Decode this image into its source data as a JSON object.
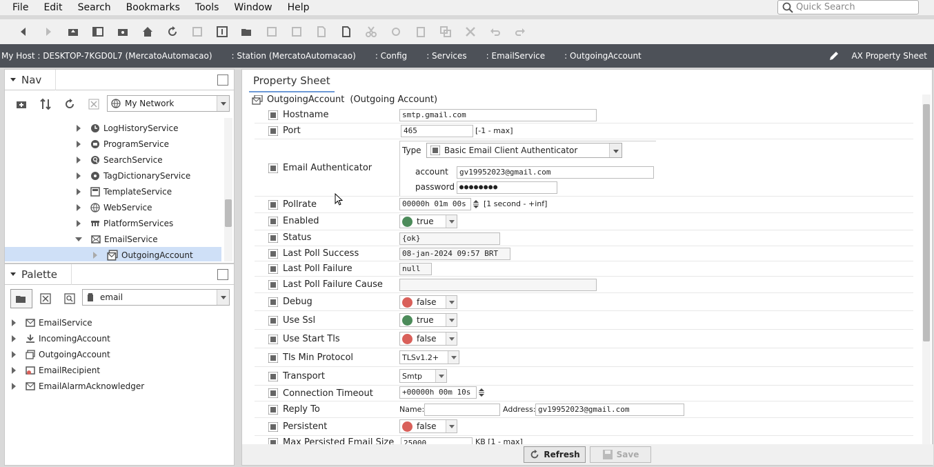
{
  "menu": [
    "File",
    "Edit",
    "Search",
    "Bookmarks",
    "Tools",
    "Window",
    "Help"
  ],
  "quick_search": {
    "placeholder": "Quick Search"
  },
  "breadcrumbs": [
    "My Host : DESKTOP-7KGD0L7 (MercatoAutomacao)",
    "Station (MercatoAutomacao)",
    "Config",
    "Services",
    "EmailService",
    "OutgoingAccount"
  ],
  "view_selector": "AX Property Sheet",
  "nav": {
    "title": "Nav",
    "network": "My Network",
    "items": [
      {
        "label": "LogHistoryService",
        "icon": "history-icon"
      },
      {
        "label": "ProgramService",
        "icon": "program-icon"
      },
      {
        "label": "SearchService",
        "icon": "search-icon"
      },
      {
        "label": "TagDictionaryService",
        "icon": "tag-icon"
      },
      {
        "label": "TemplateService",
        "icon": "template-icon"
      },
      {
        "label": "WebService",
        "icon": "globe-icon"
      },
      {
        "label": "PlatformServices",
        "icon": "platform-icon"
      },
      {
        "label": "EmailService",
        "icon": "email-icon"
      },
      {
        "label": "OutgoingAccount",
        "icon": "outgoing-mail-icon"
      }
    ]
  },
  "palette": {
    "title": "Palette",
    "module": "email",
    "items": [
      "EmailService",
      "IncomingAccount",
      "OutgoingAccount",
      "EmailRecipient",
      "EmailAlarmAcknowledger"
    ]
  },
  "property_sheet": {
    "tab": "Property Sheet",
    "root_name": "OutgoingAccount",
    "root_type": "(Outgoing Account)",
    "hostname": {
      "label": "Hostname",
      "value": "smtp.gmail.com"
    },
    "port": {
      "label": "Port",
      "value": "465",
      "hint": "[-1 - max]"
    },
    "authenticator": {
      "label": "Email Authenticator",
      "type_label": "Type",
      "type_value": "Basic Email Client Authenticator",
      "account_label": "account",
      "account_value": "gv19952023@gmail.com",
      "password_label": "password",
      "password_value": "●●●●●●●●"
    },
    "pollrate": {
      "label": "Pollrate",
      "value": "00000h 01m 00s",
      "hint": "[1 second - +inf]"
    },
    "enabled": {
      "label": "Enabled",
      "value": "true"
    },
    "status": {
      "label": "Status",
      "value": "{ok}"
    },
    "last_poll_success": {
      "label": "Last Poll Success",
      "value": "08-jan-2024 09:57 BRT"
    },
    "last_poll_failure": {
      "label": "Last Poll Failure",
      "value": "null"
    },
    "last_poll_failure_cause": {
      "label": "Last Poll Failure Cause",
      "value": ""
    },
    "debug": {
      "label": "Debug",
      "value": "false"
    },
    "use_ssl": {
      "label": "Use Ssl",
      "value": "true"
    },
    "use_start_tls": {
      "label": "Use Start Tls",
      "value": "false"
    },
    "tls_min_protocol": {
      "label": "Tls Min Protocol",
      "value": "TLSv1.2+"
    },
    "transport": {
      "label": "Transport",
      "value": "Smtp"
    },
    "connection_timeout": {
      "label": "Connection Timeout",
      "value": "+00000h 00m 10s"
    },
    "reply_to": {
      "label": "Reply To",
      "name_label": "Name:",
      "name_value": "",
      "address_label": "Address:",
      "address_value": "gv19952023@gmail.com"
    },
    "persistent": {
      "label": "Persistent",
      "value": "false"
    },
    "max_persisted": {
      "label": "Max Persisted Email Size",
      "value": "25000",
      "hint": "KB [1 - max]"
    }
  },
  "buttons": {
    "refresh": "Refresh",
    "save": "Save"
  },
  "colors": {
    "true": "#4c8b5a",
    "false": "#d9605a",
    "pathbar": "#4d5158",
    "accent": "#6b98d6"
  }
}
